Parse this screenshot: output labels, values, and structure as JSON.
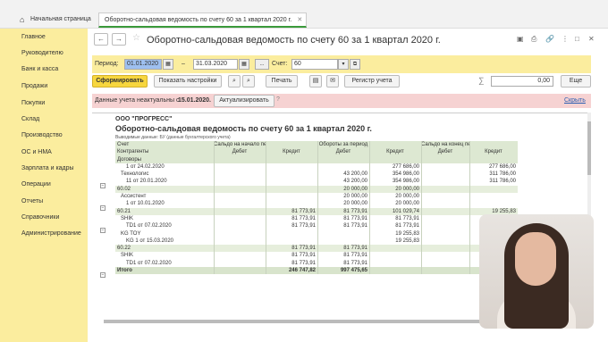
{
  "tabs": {
    "home": "Начальная страница",
    "doc": "Оборотно-сальдовая ведомость по счету 60 за 1 квартал 2020 г."
  },
  "sidebar": {
    "items": [
      {
        "label": "Главное"
      },
      {
        "label": "Руководителю"
      },
      {
        "label": "Банк и касса"
      },
      {
        "label": "Продажи"
      },
      {
        "label": "Покупки"
      },
      {
        "label": "Склад"
      },
      {
        "label": "Производство"
      },
      {
        "label": "ОС и НМА"
      },
      {
        "label": "Зарплата и кадры"
      },
      {
        "label": "Операции"
      },
      {
        "label": "Отчеты"
      },
      {
        "label": "Справочники"
      },
      {
        "label": "Администрирование"
      }
    ]
  },
  "header": {
    "title": "Оборотно-сальдовая ведомость по счету 60 за 1 квартал 2020 г."
  },
  "params": {
    "period_label": "Период:",
    "date_from": "01.01.2020",
    "dash": "–",
    "date_to": "31.03.2020",
    "ellipsis": "...",
    "account_label": "Счет:",
    "account_value": "60"
  },
  "toolbar": {
    "generate": "Сформировать",
    "show_settings": "Показать настройки",
    "print": "Печать",
    "register": "Регистр учета",
    "sum_value": "0,00",
    "more": "Еще"
  },
  "warning": {
    "text": "Данные учета неактуальны с",
    "date": "15.01.2020.",
    "update": "Актуализировать",
    "hide": "Скрыть"
  },
  "report": {
    "org": "ООО \"ПРОГРЕСС\"",
    "title": "Оборотно-сальдовая ведомость по счету 60 за 1 квартал 2020 г.",
    "subtitle": "Выводимые данные:  БУ (данные бухгалтерского учета)",
    "header_rows": [
      [
        "Счет",
        "Сальдо на начало периода",
        "",
        "Обороты за период",
        "",
        "Сальдо на конец периода",
        ""
      ],
      [
        "Контрагенты",
        "Дебет",
        "Кредит",
        "Дебет",
        "Кредит",
        "Дебет",
        "Кредит"
      ],
      [
        "Договоры",
        "",
        "",
        "",
        "",
        "",
        ""
      ]
    ],
    "rows": [
      {
        "kind": "row",
        "c": [
          "1 от 24.02.2020",
          "",
          "",
          "",
          "277 686,00",
          "",
          "277 686,00"
        ],
        "indent": 10
      },
      {
        "kind": "row",
        "c": [
          "Технологис",
          "",
          "",
          "43 200,00",
          "354 986,00",
          "",
          "311 786,00"
        ],
        "indent": 4
      },
      {
        "kind": "row",
        "c": [
          "11 от 20.01.2020",
          "",
          "",
          "43 200,00",
          "354 986,00",
          "",
          "311 786,00"
        ],
        "indent": 10
      },
      {
        "kind": "grp",
        "c": [
          "60.02",
          "",
          "",
          "20 000,00",
          "20 000,00",
          "",
          ""
        ],
        "indent": 0
      },
      {
        "kind": "row",
        "c": [
          "Ассистент",
          "",
          "",
          "20 000,00",
          "20 000,00",
          "",
          ""
        ],
        "indent": 4
      },
      {
        "kind": "row",
        "c": [
          "1 от 10.01.2020",
          "",
          "",
          "20 000,00",
          "20 000,00",
          "",
          ""
        ],
        "indent": 10
      },
      {
        "kind": "grp",
        "c": [
          "60.21",
          "",
          "81 773,91",
          "81 773,91",
          "101 029,74",
          "",
          "19 255,83"
        ],
        "indent": 0
      },
      {
        "kind": "row",
        "c": [
          "SHIK",
          "",
          "81 773,91",
          "81 773,91",
          "81 773,91",
          "",
          ""
        ],
        "indent": 4
      },
      {
        "kind": "row",
        "c": [
          "TD1 от 07.02.2020",
          "",
          "81 773,91",
          "81 773,91",
          "81 773,91",
          "",
          ""
        ],
        "indent": 10
      },
      {
        "kind": "row",
        "c": [
          "KG TOY",
          "",
          "",
          "",
          "19 255,83",
          "",
          "19 255,83"
        ],
        "indent": 4
      },
      {
        "kind": "row",
        "c": [
          "KG 1 от 15.03.2020",
          "",
          "",
          "",
          "19 255,83",
          "",
          "19 255,83"
        ],
        "indent": 10
      },
      {
        "kind": "grp",
        "c": [
          "60.22",
          "",
          "81 773,91",
          "81 773,91",
          "",
          "",
          ""
        ],
        "indent": 0
      },
      {
        "kind": "row",
        "c": [
          "SHIK",
          "",
          "81 773,91",
          "81 773,91",
          "",
          "",
          ""
        ],
        "indent": 4
      },
      {
        "kind": "row",
        "c": [
          "TD1 от 07.02.2020",
          "",
          "81 773,91",
          "81 773,91",
          "",
          "",
          ""
        ],
        "indent": 10
      },
      {
        "kind": "tot",
        "c": [
          "Итого",
          "",
          "246 747,82",
          "997 475,65",
          "",
          "",
          ""
        ],
        "indent": 0
      }
    ]
  },
  "colors": {
    "sidebar_bg": "#fbed9e",
    "primary_btn": "#f7d63e",
    "warning_bg": "#f6d2d2",
    "table_header_bg": "#dde8d2",
    "active_tab_accent": "#3b9a3b"
  }
}
